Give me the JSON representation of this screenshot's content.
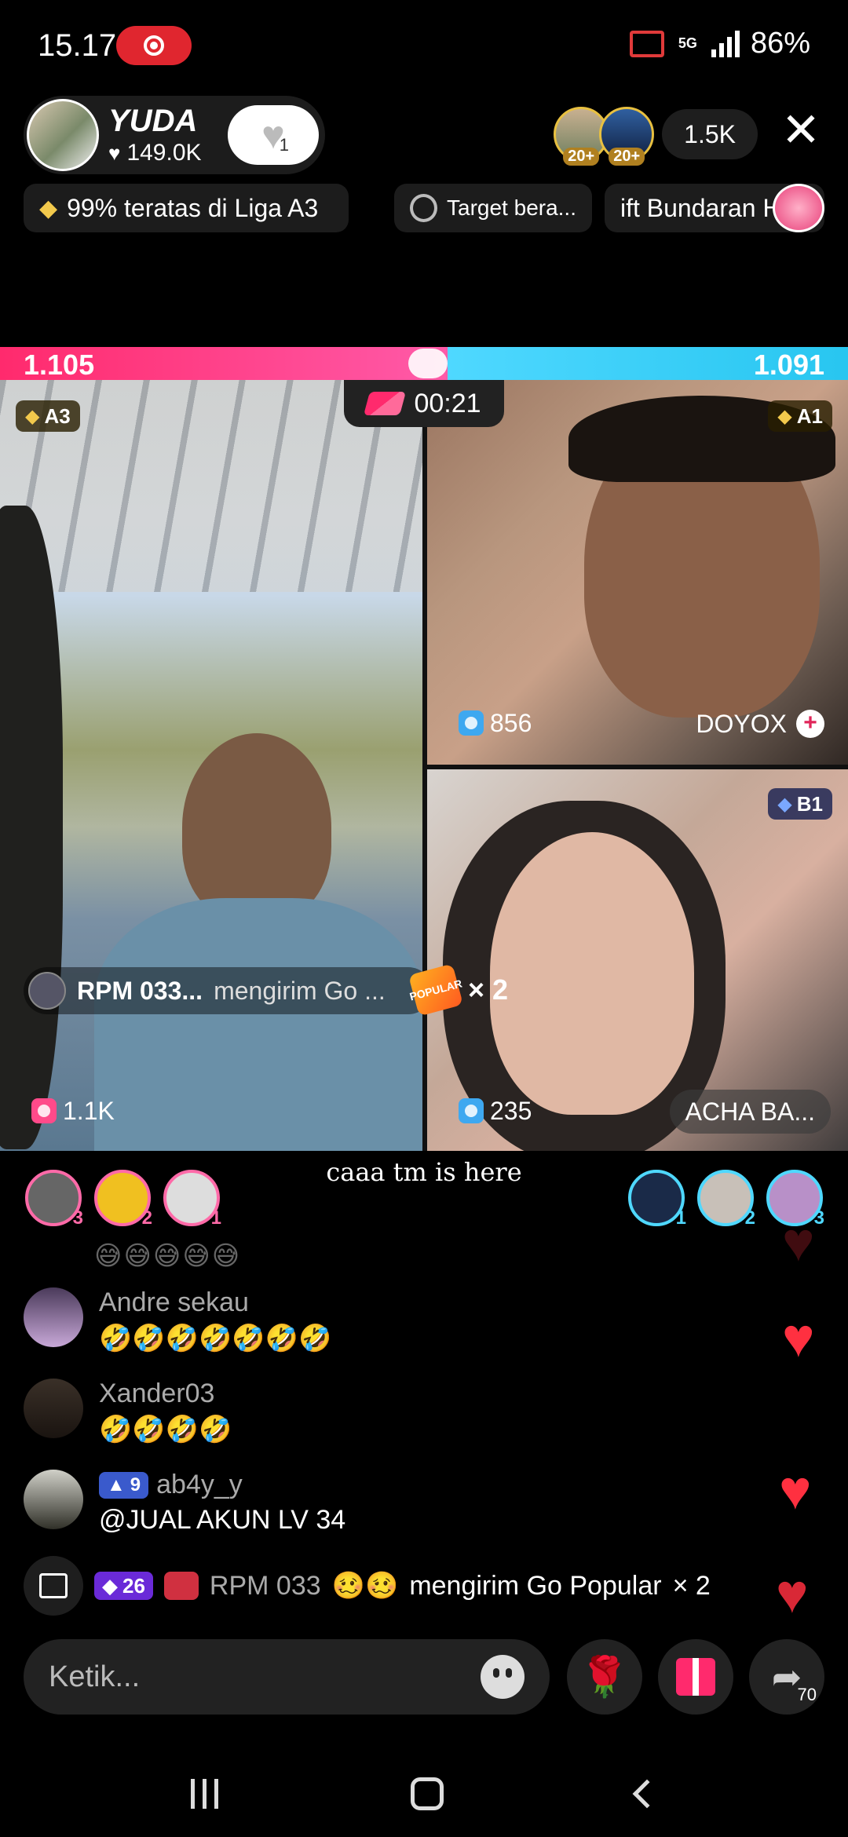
{
  "status_bar": {
    "time": "15.17",
    "battery": "86%",
    "network": "5G"
  },
  "host": {
    "name": "YUDA",
    "likes": "149.0K",
    "follow_count": "1"
  },
  "viewers": {
    "badges": [
      "20+",
      "20+"
    ],
    "count": "1.5K"
  },
  "chips": {
    "league": "99% teratas di Liga A3",
    "target": "Target bera...",
    "gift_banner": "ift Bundaran H"
  },
  "battle": {
    "score_left": "1.105",
    "score_right": "1.091",
    "timer": "00:21",
    "left": {
      "rank": "A3",
      "gifts": "1.1K"
    },
    "top_right": {
      "rank": "A1",
      "gifts": "856",
      "name": "DOYOX"
    },
    "bottom_right": {
      "rank": "B1",
      "gifts": "235",
      "name": "ACHA BA..."
    }
  },
  "gift_notice": {
    "user": "RPM 033...",
    "action": "mengirim Go ...",
    "badge": "POPULAR",
    "multiplier": "× 2"
  },
  "supporters_left": [
    "3",
    "2",
    "1"
  ],
  "supporters_right": [
    "1",
    "2",
    "3"
  ],
  "join_text": "caaa tm is here",
  "chat": [
    {
      "name": "Andre sekau",
      "message": "🤣🤣🤣🤣🤣🤣🤣"
    },
    {
      "name": "Xander03",
      "message": "🤣🤣🤣🤣"
    },
    {
      "name": "ab4y_y",
      "level": "9",
      "message": "@JUAL AKUN LV 34"
    }
  ],
  "gift_line": {
    "tier": "26",
    "user": "RPM 033",
    "emoji": "🥴🥴",
    "text": "mengirim Go Popular",
    "multiplier": "× 2"
  },
  "input": {
    "placeholder": "Ketik..."
  },
  "share_count": "70",
  "colors": {
    "pink": "#ff2a6d",
    "blue": "#4fd8ff",
    "heart": "#ff3040"
  }
}
